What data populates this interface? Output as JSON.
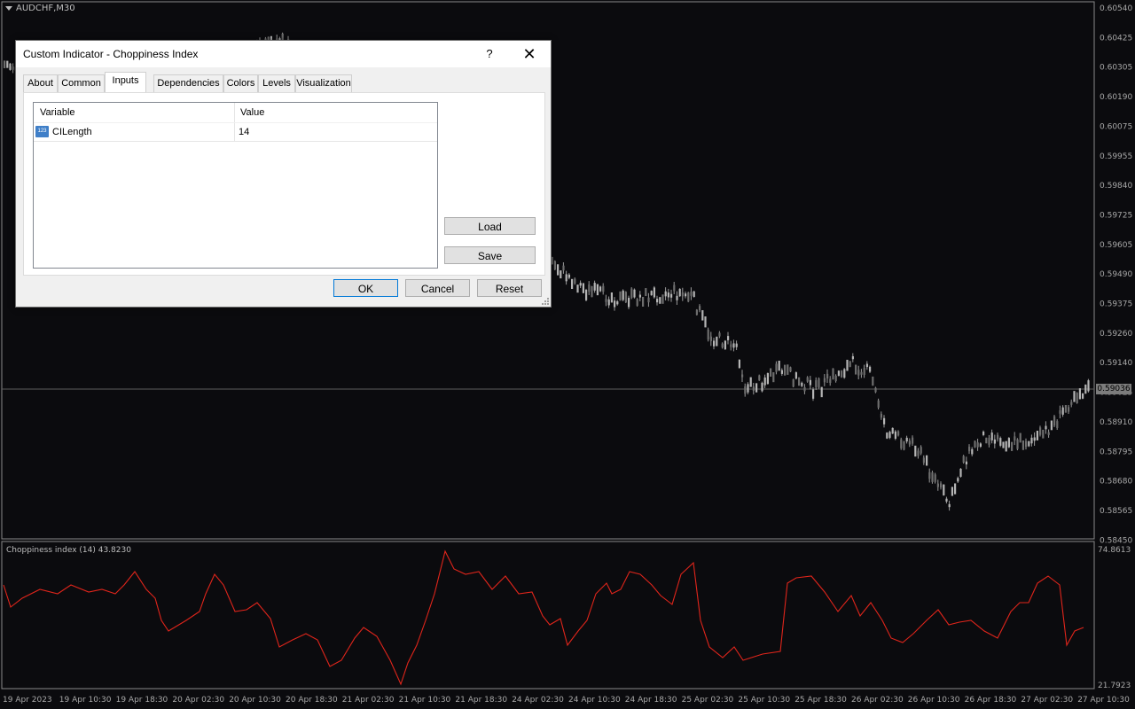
{
  "chart": {
    "symbol": "AUDCHF,M30",
    "current_price": "0.59036",
    "price_axis": [
      "0.60540",
      "0.60425",
      "0.60305",
      "0.60190",
      "0.60075",
      "0.59955",
      "0.59840",
      "0.59725",
      "0.59605",
      "0.59490",
      "0.59375",
      "0.59260",
      "0.59140",
      "0.59025",
      "0.58910",
      "0.58795",
      "0.58680",
      "0.58565",
      "0.58450"
    ],
    "time_axis": [
      "19 Apr 2023",
      "19 Apr 10:30",
      "19 Apr 18:30",
      "20 Apr 02:30",
      "20 Apr 10:30",
      "20 Apr 18:30",
      "21 Apr 02:30",
      "21 Apr 10:30",
      "21 Apr 18:30",
      "24 Apr 02:30",
      "24 Apr 10:30",
      "24 Apr 18:30",
      "25 Apr 02:30",
      "25 Apr 10:30",
      "25 Apr 18:30",
      "26 Apr 02:30",
      "26 Apr 10:30",
      "26 Apr 18:30",
      "27 Apr 02:30",
      "27 Apr 10:30"
    ],
    "indicator_label": "Choppiness index (14) 43.8230",
    "indicator_max": "74.8613",
    "indicator_min": "21.7923"
  },
  "dialog": {
    "title": "Custom Indicator - Choppiness Index",
    "help_label": "?",
    "close_label": "✕",
    "tabs": [
      "About",
      "Common",
      "Inputs",
      "Dependencies",
      "Colors",
      "Levels",
      "Visualization"
    ],
    "active_tab": "Inputs",
    "table": {
      "headers": [
        "Variable",
        "Value"
      ],
      "rows": [
        {
          "icon": "123",
          "variable": "CILength",
          "value": "14"
        }
      ]
    },
    "buttons": {
      "load": "Load",
      "save": "Save",
      "ok": "OK",
      "cancel": "Cancel",
      "reset": "Reset"
    }
  },
  "colors": {
    "background": "#0b0b0e",
    "candles": "#a0a0a0",
    "indicator_line": "#e0251b",
    "axis_text": "#a8a8a8"
  }
}
